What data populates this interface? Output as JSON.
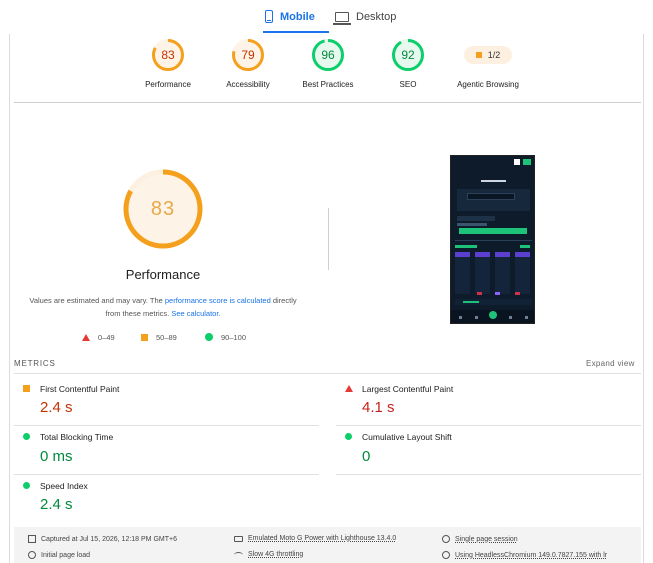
{
  "tabs": {
    "mobile": "Mobile",
    "desktop": "Desktop",
    "active": "mobile"
  },
  "scores": [
    {
      "label": "Performance",
      "value": "83",
      "score": 0.83,
      "color": "#f4a01c",
      "text_color": "#c33300"
    },
    {
      "label": "Accessibility",
      "value": "79",
      "score": 0.79,
      "color": "#f4a01c",
      "text_color": "#c33300"
    },
    {
      "label": "Best Practices",
      "value": "96",
      "score": 0.96,
      "color": "#0cce6b",
      "text_color": "#008a3e"
    },
    {
      "label": "SEO",
      "value": "92",
      "score": 0.92,
      "color": "#0cce6b",
      "text_color": "#008a3e"
    }
  ],
  "agentic": {
    "label": "Agentic Browsing",
    "value": "1/2"
  },
  "performance": {
    "score": "83",
    "score_fraction": 0.83,
    "title": "Performance",
    "note_prefix": "Values are estimated and may vary. The ",
    "note_link1": "performance score is calculated",
    "note_middle": " directly from these metrics. ",
    "note_link2": "See calculator.",
    "ring_color": "#f4a01c",
    "ring_bg": "#fdf0e0"
  },
  "legend": {
    "fail": "0–49",
    "average": "50–89",
    "pass": "90–100"
  },
  "metrics": {
    "title": "METRICS",
    "expand": "Expand view",
    "items": [
      {
        "label": "First Contentful Paint",
        "value": "2.4 s",
        "status": "average"
      },
      {
        "label": "Largest Contentful Paint",
        "value": "4.1 s",
        "status": "fail"
      },
      {
        "label": "Total Blocking Time",
        "value": "0 ms",
        "status": "pass"
      },
      {
        "label": "Cumulative Layout Shift",
        "value": "0",
        "status": "pass"
      },
      {
        "label": "Speed Index",
        "value": "2.4 s",
        "status": "pass"
      }
    ]
  },
  "footer": {
    "captured": "Captured at Jul 15, 2026, 12:18 PM GMT+6",
    "device": "Emulated Moto G Power with Lighthouse 13.4.0",
    "session": "Single page session",
    "load": "Initial page load",
    "throttling": "Slow 4G throttling",
    "browser": "Using HeadlessChromium 149.0.7827.155 with lr"
  },
  "colors": {
    "accent": "#1a73e8",
    "pass": "#0cce6b",
    "average": "#f4a01c",
    "fail": "#e53935"
  }
}
